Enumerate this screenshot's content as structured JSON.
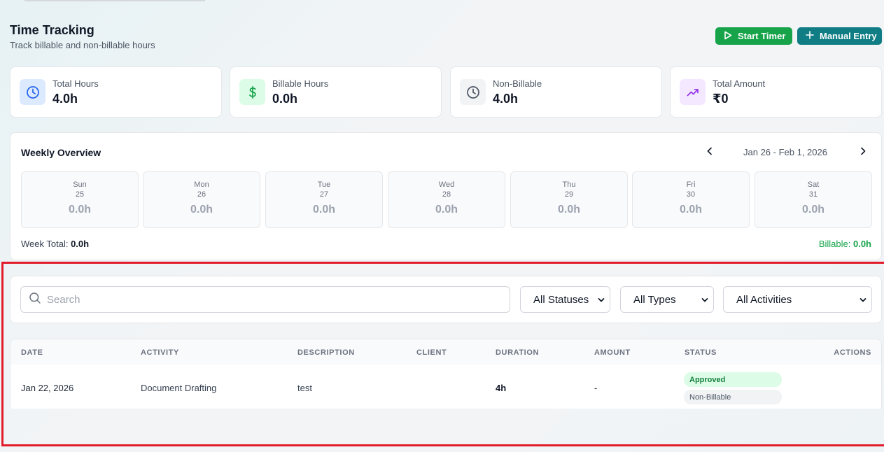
{
  "header": {
    "title": "Time Tracking",
    "subtitle": "Track billable and non-billable hours",
    "start_timer_label": "Start Timer",
    "manual_entry_label": "Manual Entry"
  },
  "stats": [
    {
      "label": "Total Hours",
      "value": "4.0h",
      "icon": "clock-icon",
      "color": "#2563eb"
    },
    {
      "label": "Billable Hours",
      "value": "0.0h",
      "icon": "dollar-icon",
      "color": "#16a34a"
    },
    {
      "label": "Non-Billable",
      "value": "4.0h",
      "icon": "clock-icon",
      "color": "#4b5563"
    },
    {
      "label": "Total Amount",
      "value": "₹0",
      "icon": "trending-up-icon",
      "color": "#9333ea"
    }
  ],
  "weekly": {
    "title": "Weekly Overview",
    "range": "Jan 26 - Feb 1, 2026",
    "days": [
      {
        "name": "Sun",
        "date": "25",
        "hours": "0.0h"
      },
      {
        "name": "Mon",
        "date": "26",
        "hours": "0.0h"
      },
      {
        "name": "Tue",
        "date": "27",
        "hours": "0.0h"
      },
      {
        "name": "Wed",
        "date": "28",
        "hours": "0.0h"
      },
      {
        "name": "Thu",
        "date": "29",
        "hours": "0.0h"
      },
      {
        "name": "Fri",
        "date": "30",
        "hours": "0.0h"
      },
      {
        "name": "Sat",
        "date": "31",
        "hours": "0.0h"
      }
    ],
    "week_total_label": "Week Total:",
    "week_total_value": "0.0h",
    "billable_label": "Billable:",
    "billable_value": "0.0h"
  },
  "filters": {
    "search_placeholder": "Search",
    "status": "All Statuses",
    "type": "All Types",
    "activity": "All Activities"
  },
  "table": {
    "columns": [
      "DATE",
      "ACTIVITY",
      "DESCRIPTION",
      "CLIENT",
      "DURATION",
      "AMOUNT",
      "STATUS",
      "ACTIONS"
    ],
    "rows": [
      {
        "date": "Jan 22, 2026",
        "activity": "Document Drafting",
        "description": "test",
        "client": "",
        "duration": "4h",
        "amount": "-",
        "status": "Approved",
        "billing_type": "Non-Billable"
      }
    ]
  },
  "colors": {
    "start_timer": "#16a34a",
    "manual_entry": "#0f7d83",
    "approved": "#15803d",
    "highlight_frame": "#e11d2b"
  }
}
